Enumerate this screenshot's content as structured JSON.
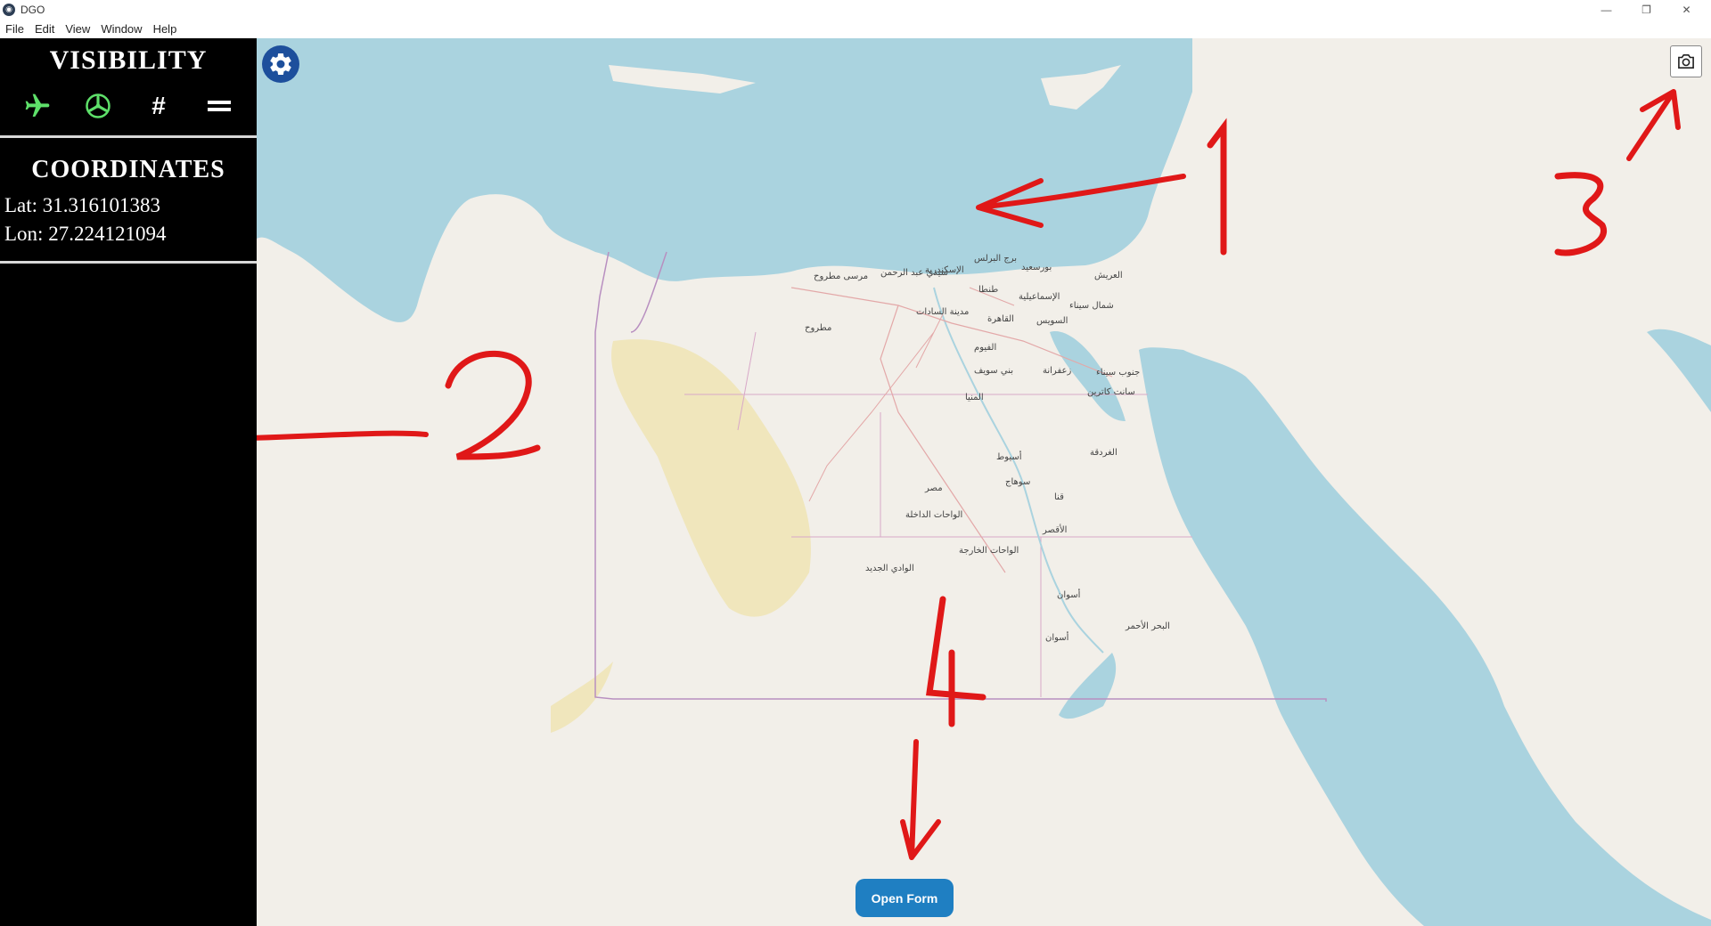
{
  "window": {
    "title": "DGO",
    "controls": [
      "minimize",
      "restore",
      "close"
    ]
  },
  "menu": [
    "File",
    "Edit",
    "View",
    "Window",
    "Help"
  ],
  "sidebar": {
    "visibility_title": "VISIBILITY",
    "icons": [
      {
        "name": "airplane-icon",
        "glyph": "✈",
        "color": "#5ee06a"
      },
      {
        "name": "helicopter-icon",
        "glyph": "✇",
        "color": "#5ee06a"
      },
      {
        "name": "hash-icon",
        "glyph": "#",
        "color": "#ffffff"
      },
      {
        "name": "equals-icon",
        "glyph": "=",
        "color": "#ffffff"
      }
    ],
    "coordinates_title": "COORDINATES",
    "lat": "Lat: 31.316101383",
    "lon": "Lon: 27.224121094"
  },
  "map": {
    "button_label": "Open Form",
    "cities": [
      {
        "name": "برج البرلس"
      },
      {
        "name": "بورسعيد"
      },
      {
        "name": "العريش"
      },
      {
        "name": "الإسكندرية"
      },
      {
        "name": "سيدي عبد الرحمن"
      },
      {
        "name": "مرسى مطروح"
      },
      {
        "name": "طنطا"
      },
      {
        "name": "الإسماعيلية"
      },
      {
        "name": "شمال سيناء"
      },
      {
        "name": "مدينة السادات"
      },
      {
        "name": "القاهرة"
      },
      {
        "name": "السويس"
      },
      {
        "name": "مطروح"
      },
      {
        "name": "الفيوم"
      },
      {
        "name": "بني سويف"
      },
      {
        "name": "زعفرانة"
      },
      {
        "name": "جنوب سيناء"
      },
      {
        "name": "سانت كاترين"
      },
      {
        "name": "المنيا"
      },
      {
        "name": "الغردقة"
      },
      {
        "name": "أسيوط"
      },
      {
        "name": "سوهاج"
      },
      {
        "name": "مصر"
      },
      {
        "name": "قنا"
      },
      {
        "name": "الواحات الداخلة"
      },
      {
        "name": "الأقصر"
      },
      {
        "name": "الواحات الخارجة"
      },
      {
        "name": "الوادي الجديد"
      },
      {
        "name": "أسوان"
      },
      {
        "name": "البحر الأحمر"
      },
      {
        "name": "أسوان"
      }
    ],
    "annotations": [
      "1",
      "2",
      "3",
      "4"
    ],
    "colors": {
      "sea": "#aad3df",
      "land": "#f2efe9",
      "desert": "#efe4b0",
      "annotation": "#e01818",
      "button": "#1f7fc2"
    }
  }
}
